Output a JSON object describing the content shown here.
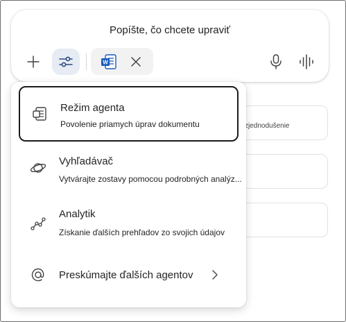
{
  "composer": {
    "prompt_text": "Popíšte, čo chcete upraviť",
    "icons": {
      "add": "plus-icon",
      "tools": "sliders-icon",
      "attachment": "word-document-icon",
      "remove_attachment": "close-icon",
      "microphone": "microphone-icon",
      "voice": "voice-waveform-icon"
    }
  },
  "background_cards": [
    {
      "text": "zjednodušenie"
    },
    {
      "text": ""
    },
    {
      "text": ""
    }
  ],
  "menu": {
    "items": [
      {
        "title": "Režim agenta",
        "description": "Povolenie priamych úprav dokumentu",
        "icon": "word-agent-icon",
        "selected": true
      },
      {
        "title": "Vyhľadávač",
        "description": "Vytvárajte zostavy pomocou podrobných analýz...",
        "icon": "planet-icon",
        "selected": false
      },
      {
        "title": "Analytik",
        "description": "Získanie ďalších prehľadov zo svojich údajov",
        "icon": "line-chart-icon",
        "selected": false
      },
      {
        "title": "Preskúmajte ďalších agentov",
        "description": "",
        "icon": "at-sign-icon",
        "chevron": "chevron-right-icon",
        "selected": false
      }
    ]
  },
  "colors": {
    "selected_border": "#1a1a1a",
    "tools_active_bg": "#e6ebf4",
    "word_blue": "#185abd"
  }
}
